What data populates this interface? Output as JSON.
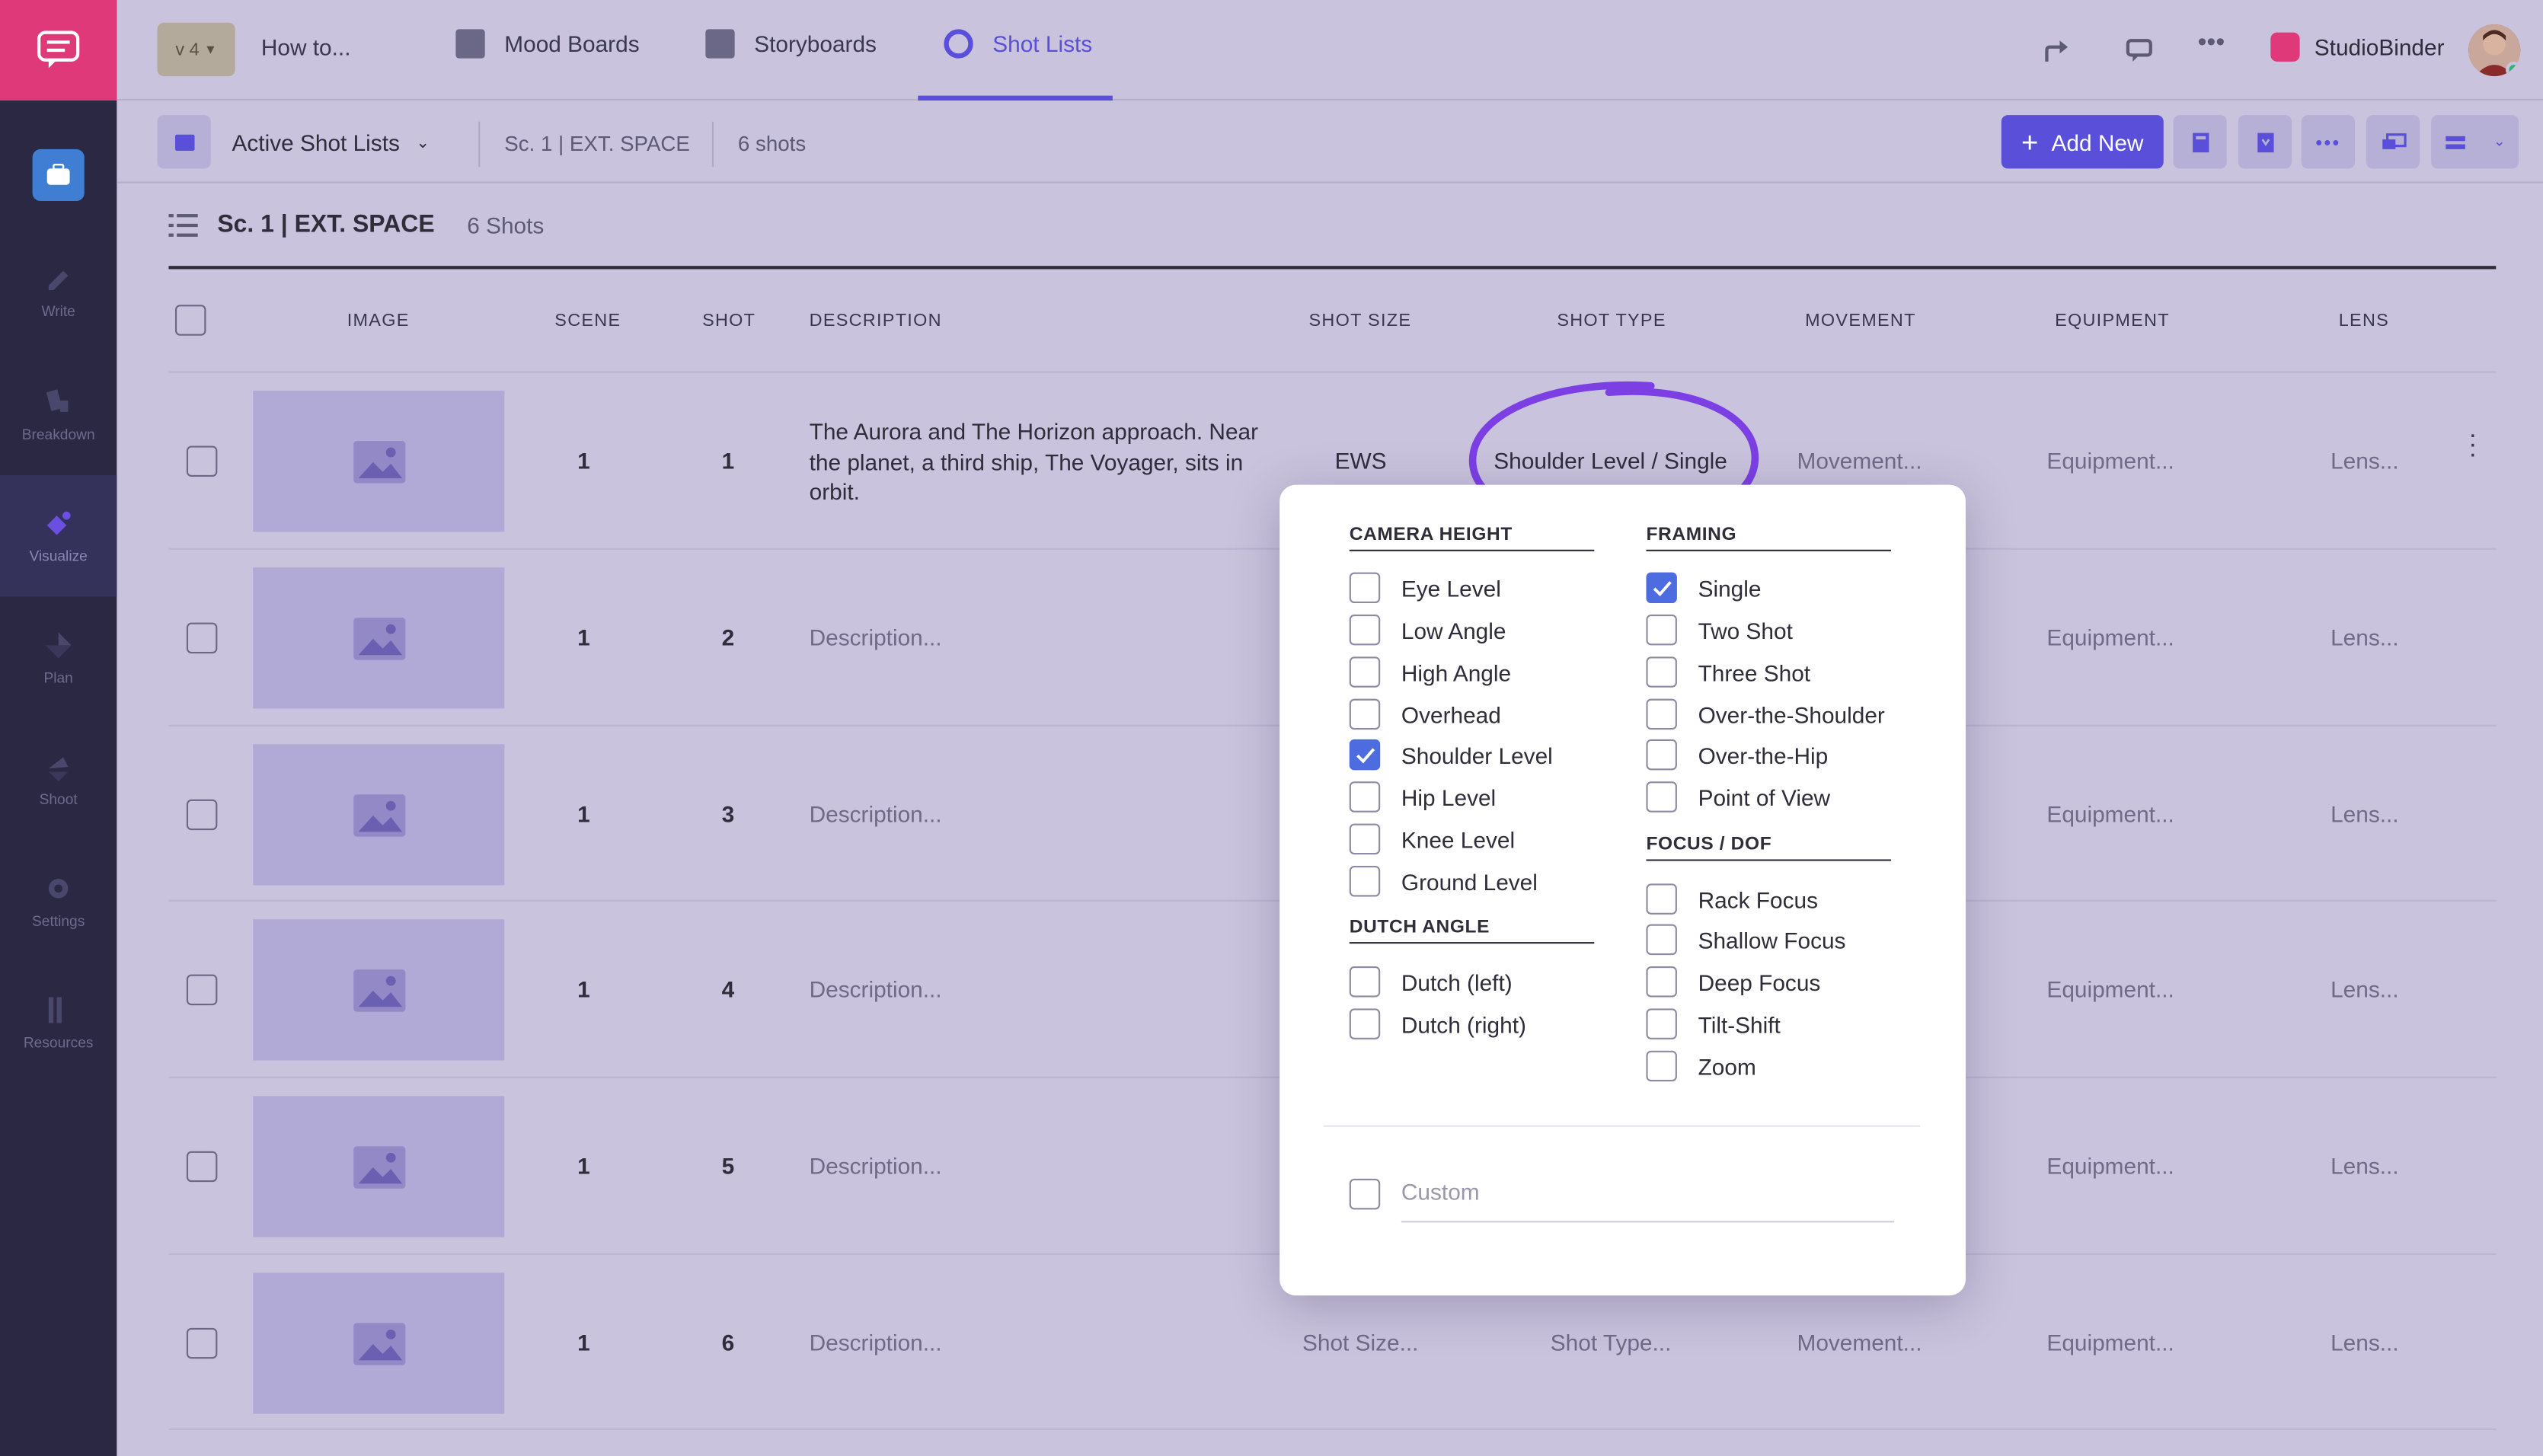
{
  "sidebar": {
    "items": [
      {
        "label": "Write"
      },
      {
        "label": "Breakdown"
      },
      {
        "label": "Visualize"
      },
      {
        "label": "Plan"
      },
      {
        "label": "Shoot"
      },
      {
        "label": "Settings"
      },
      {
        "label": "Resources"
      }
    ]
  },
  "topbar": {
    "version": "v 4",
    "project": "How to...",
    "tabs": [
      {
        "label": "Mood Boards"
      },
      {
        "label": "Storyboards"
      },
      {
        "label": "Shot Lists"
      }
    ],
    "brand": "StudioBinder"
  },
  "subbar": {
    "view": "Active Shot Lists",
    "scene": "Sc. 1 | EXT. SPACE",
    "count": "6 shots",
    "add_new": "Add New"
  },
  "section": {
    "title": "Sc. 1 | EXT. SPACE",
    "count": "6 Shots"
  },
  "table": {
    "headers": {
      "image": "IMAGE",
      "scene": "SCENE",
      "shot": "SHOT",
      "description": "DESCRIPTION",
      "shot_size": "SHOT SIZE",
      "shot_type": "SHOT TYPE",
      "movement": "MOVEMENT",
      "equipment": "EQUIPMENT",
      "lens": "LENS"
    },
    "rows": [
      {
        "scene": "1",
        "shot": "1",
        "description": "The Aurora and The Horizon approach. Near the planet, a third ship, The Voyager, sits in orbit.",
        "shot_size": "EWS",
        "shot_type": "Shoulder Level / Single",
        "movement": "Movement...",
        "equipment": "Equipment...",
        "lens": "Lens..."
      },
      {
        "scene": "1",
        "shot": "2",
        "description": "Description...",
        "equipment": "Equipment...",
        "lens": "Lens..."
      },
      {
        "scene": "1",
        "shot": "3",
        "description": "Description...",
        "equipment": "Equipment...",
        "lens": "Lens..."
      },
      {
        "scene": "1",
        "shot": "4",
        "description": "Description...",
        "equipment": "Equipment...",
        "lens": "Lens..."
      },
      {
        "scene": "1",
        "shot": "5",
        "description": "Description...",
        "equipment": "Equipment...",
        "lens": "Lens..."
      },
      {
        "scene": "1",
        "shot": "6",
        "description": "Description...",
        "shot_size": "Shot Size...",
        "shot_type": "Shot Type...",
        "movement": "Movement...",
        "equipment": "Equipment...",
        "lens": "Lens..."
      }
    ]
  },
  "popover": {
    "camera_height": {
      "title": "CAMERA HEIGHT",
      "options": [
        {
          "label": "Eye Level",
          "checked": false
        },
        {
          "label": "Low Angle",
          "checked": false
        },
        {
          "label": "High Angle",
          "checked": false
        },
        {
          "label": "Overhead",
          "checked": false
        },
        {
          "label": "Shoulder Level",
          "checked": true
        },
        {
          "label": "Hip Level",
          "checked": false
        },
        {
          "label": "Knee Level",
          "checked": false
        },
        {
          "label": "Ground Level",
          "checked": false
        }
      ]
    },
    "dutch_angle": {
      "title": "DUTCH ANGLE",
      "options": [
        {
          "label": "Dutch (left)",
          "checked": false
        },
        {
          "label": "Dutch (right)",
          "checked": false
        }
      ]
    },
    "framing": {
      "title": "FRAMING",
      "options": [
        {
          "label": "Single",
          "checked": true
        },
        {
          "label": "Two Shot",
          "checked": false
        },
        {
          "label": "Three Shot",
          "checked": false
        },
        {
          "label": "Over-the-Shoulder",
          "checked": false
        },
        {
          "label": "Over-the-Hip",
          "checked": false
        },
        {
          "label": "Point of View",
          "checked": false
        }
      ]
    },
    "focus": {
      "title": "FOCUS / DOF",
      "options": [
        {
          "label": "Rack Focus",
          "checked": false
        },
        {
          "label": "Shallow Focus",
          "checked": false
        },
        {
          "label": "Deep Focus",
          "checked": false
        },
        {
          "label": "Tilt-Shift",
          "checked": false
        },
        {
          "label": "Zoom",
          "checked": false
        }
      ]
    },
    "custom_placeholder": "Custom"
  },
  "colors": {
    "accent": "#5a4fd8",
    "brand": "#e0397a",
    "checkbox_on": "#4d6ce0",
    "highlight_circle": "#7b3fe4"
  }
}
